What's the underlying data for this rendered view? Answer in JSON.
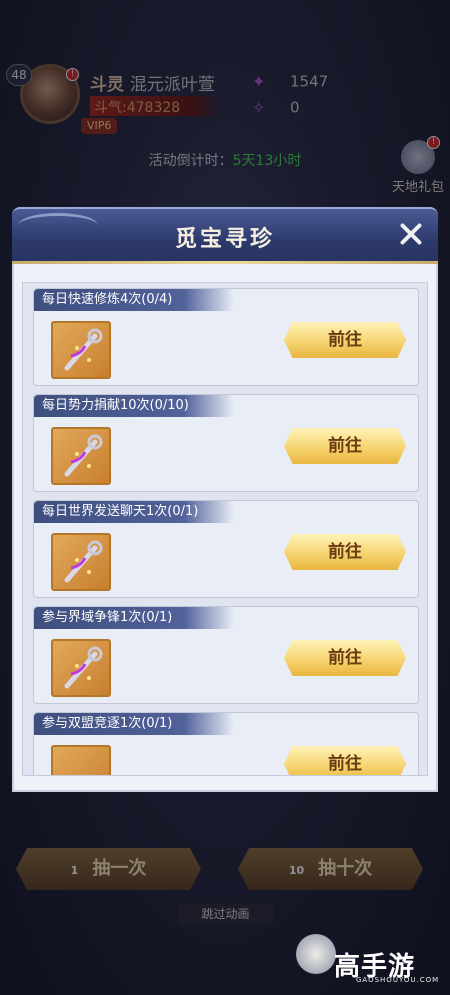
{
  "player": {
    "level": "48",
    "name": "斗灵",
    "guild": "混元派叶萱",
    "power_label": "斗气",
    "power": "478328",
    "vip": "VIP6",
    "alert": "!"
  },
  "resources": [
    {
      "icon": "flame-icon",
      "value": "1547"
    },
    {
      "icon": "crystal-icon",
      "value": "0"
    }
  ],
  "countdown": {
    "label": "活动倒计时：",
    "time": "5天13小时"
  },
  "side": {
    "gift_label": "天地礼包",
    "alert": "!"
  },
  "modal": {
    "title": "觅宝寻珍",
    "tasks": [
      {
        "title": "每日快速修炼4次(0/4)",
        "button": "前往"
      },
      {
        "title": "每日势力捐献10次(0/10)",
        "button": "前往"
      },
      {
        "title": "每日世界发送聊天1次(0/1)",
        "button": "前往"
      },
      {
        "title": "参与界域争锋1次(0/1)",
        "button": "前往"
      },
      {
        "title": "参与双盟竞逐1次(0/1)",
        "button": "前往"
      }
    ]
  },
  "draw": {
    "one": {
      "count": "1",
      "label": "抽一次"
    },
    "ten": {
      "count": "10",
      "label": "抽十次"
    }
  },
  "skip_label": "跳过动画",
  "watermark": {
    "text": "高手游",
    "sub": "GAOSHOUYOU.COM"
  },
  "colors": {
    "countdown_time": "#4bd25a",
    "go_button": "#f6d470",
    "modal_header": "#2d3a6c"
  }
}
